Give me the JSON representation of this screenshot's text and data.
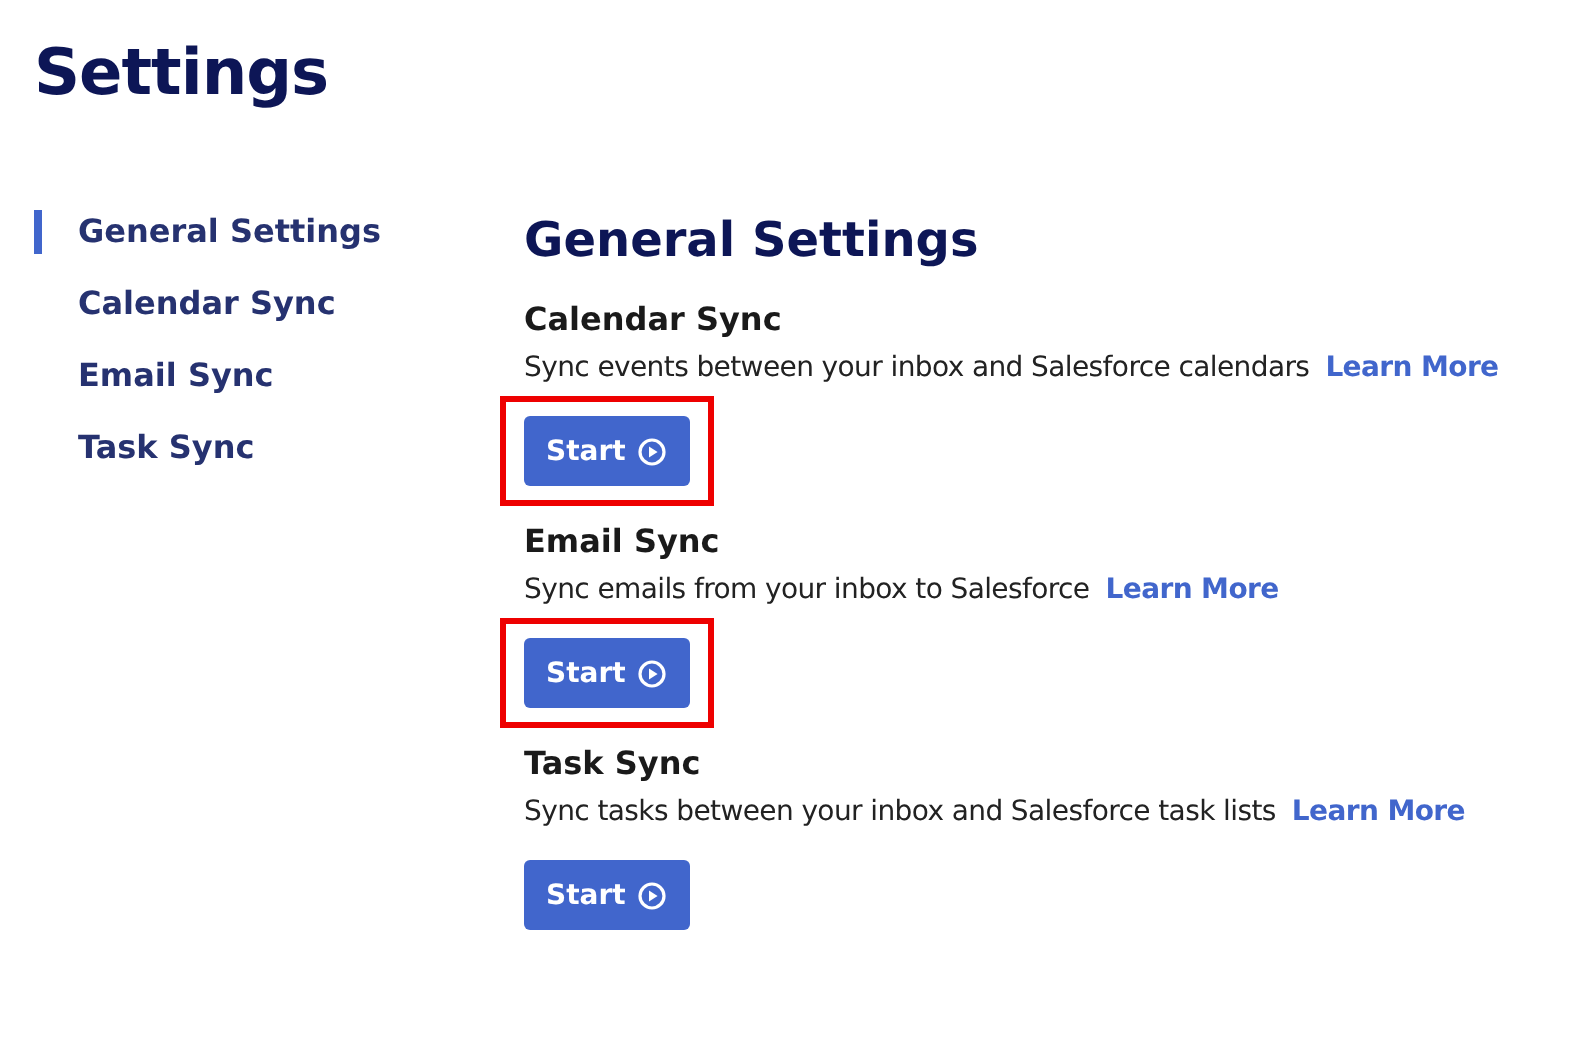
{
  "page": {
    "title": "Settings"
  },
  "sidebar": {
    "items": [
      {
        "label": "General Settings",
        "selected": true
      },
      {
        "label": "Calendar Sync",
        "selected": false
      },
      {
        "label": "Email Sync",
        "selected": false
      },
      {
        "label": "Task Sync",
        "selected": false
      }
    ]
  },
  "content": {
    "heading": "General Settings",
    "sections": [
      {
        "title": "Calendar Sync",
        "description": "Sync events between your inbox and Salesforce calendars",
        "link": "Learn More",
        "button": "Start",
        "highlighted": true
      },
      {
        "title": "Email Sync",
        "description": "Sync emails from your inbox to Salesforce",
        "link": "Learn More",
        "button": "Start",
        "highlighted": true
      },
      {
        "title": "Task Sync",
        "description": "Sync tasks between your inbox and Salesforce task lists",
        "link": "Learn More",
        "button": "Start",
        "highlighted": false
      }
    ]
  }
}
